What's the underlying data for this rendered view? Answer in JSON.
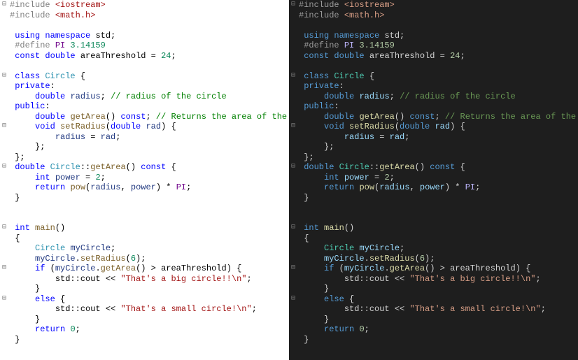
{
  "panes": [
    {
      "id": "light",
      "themeClass": "light"
    },
    {
      "id": "dark",
      "themeClass": "dark"
    }
  ],
  "code_lines": [
    {
      "fold": "-",
      "tokens": [
        [
          "t-pre",
          "#include "
        ],
        [
          "t-inc",
          "<iostream>"
        ]
      ]
    },
    {
      "fold": " ",
      "tokens": [
        [
          "t-pre",
          "#include "
        ],
        [
          "t-inc",
          "<math.h>"
        ]
      ]
    },
    {
      "fold": " ",
      "tokens": []
    },
    {
      "fold": " ",
      "tokens": [
        [
          "t-pl",
          " "
        ],
        [
          "t-kw",
          "using"
        ],
        [
          "t-pl",
          " "
        ],
        [
          "t-kw",
          "namespace"
        ],
        [
          "t-pl",
          " "
        ],
        [
          "t-id",
          "std"
        ],
        [
          "t-pl",
          ";"
        ]
      ]
    },
    {
      "fold": " ",
      "tokens": [
        [
          "t-pl",
          " "
        ],
        [
          "t-pre",
          "#define "
        ],
        [
          "t-macro",
          "PI"
        ],
        [
          "t-pl",
          " "
        ],
        [
          "t-num",
          "3.14159"
        ]
      ]
    },
    {
      "fold": " ",
      "tokens": [
        [
          "t-pl",
          " "
        ],
        [
          "t-kw",
          "const"
        ],
        [
          "t-pl",
          " "
        ],
        [
          "t-kw",
          "double"
        ],
        [
          "t-pl",
          " "
        ],
        [
          "t-id",
          "areaThreshold"
        ],
        [
          "t-pl",
          " = "
        ],
        [
          "t-num",
          "24"
        ],
        [
          "t-pl",
          ";"
        ]
      ]
    },
    {
      "fold": " ",
      "tokens": []
    },
    {
      "fold": "-",
      "tokens": [
        [
          "t-pl",
          " "
        ],
        [
          "t-kw",
          "class"
        ],
        [
          "t-pl",
          " "
        ],
        [
          "t-type",
          "Circle"
        ],
        [
          "t-pl",
          " {"
        ]
      ]
    },
    {
      "fold": " ",
      "tokens": [
        [
          "t-pl",
          " "
        ],
        [
          "t-lbl",
          "private"
        ],
        [
          "t-pl",
          ":"
        ]
      ]
    },
    {
      "fold": " ",
      "tokens": [
        [
          "t-pl",
          "     "
        ],
        [
          "t-kw",
          "double"
        ],
        [
          "t-pl",
          " "
        ],
        [
          "t-fld",
          "radius"
        ],
        [
          "t-pl",
          "; "
        ],
        [
          "t-cmt",
          "// radius of the circle"
        ]
      ]
    },
    {
      "fold": " ",
      "tokens": [
        [
          "t-pl",
          " "
        ],
        [
          "t-lbl",
          "public"
        ],
        [
          "t-pl",
          ":"
        ]
      ]
    },
    {
      "fold": " ",
      "tokens": [
        [
          "t-pl",
          "     "
        ],
        [
          "t-kw",
          "double"
        ],
        [
          "t-pl",
          " "
        ],
        [
          "t-func",
          "getArea"
        ],
        [
          "t-pl",
          "() "
        ],
        [
          "t-kw",
          "const"
        ],
        [
          "t-pl",
          "; "
        ],
        [
          "t-cmt",
          "// Returns the area of the circle"
        ]
      ]
    },
    {
      "fold": "-",
      "tokens": [
        [
          "t-pl",
          "     "
        ],
        [
          "t-kw",
          "void"
        ],
        [
          "t-pl",
          " "
        ],
        [
          "t-func",
          "setRadius"
        ],
        [
          "t-pl",
          "("
        ],
        [
          "t-kw",
          "double"
        ],
        [
          "t-pl",
          " "
        ],
        [
          "t-fld",
          "rad"
        ],
        [
          "t-pl",
          ") {"
        ]
      ]
    },
    {
      "fold": " ",
      "tokens": [
        [
          "t-pl",
          "         "
        ],
        [
          "t-fld",
          "radius"
        ],
        [
          "t-pl",
          " = "
        ],
        [
          "t-fld",
          "rad"
        ],
        [
          "t-pl",
          ";"
        ]
      ]
    },
    {
      "fold": " ",
      "tokens": [
        [
          "t-pl",
          "     };"
        ]
      ]
    },
    {
      "fold": " ",
      "tokens": [
        [
          "t-pl",
          " };"
        ]
      ]
    },
    {
      "fold": "-",
      "tokens": [
        [
          "t-pl",
          " "
        ],
        [
          "t-kw",
          "double"
        ],
        [
          "t-pl",
          " "
        ],
        [
          "t-scope",
          "Circle"
        ],
        [
          "t-pl",
          "::"
        ],
        [
          "t-func",
          "getArea"
        ],
        [
          "t-pl",
          "() "
        ],
        [
          "t-kw",
          "const"
        ],
        [
          "t-pl",
          " {"
        ]
      ]
    },
    {
      "fold": " ",
      "tokens": [
        [
          "t-pl",
          "     "
        ],
        [
          "t-kw",
          "int"
        ],
        [
          "t-pl",
          " "
        ],
        [
          "t-fld",
          "power"
        ],
        [
          "t-pl",
          " = "
        ],
        [
          "t-num",
          "2"
        ],
        [
          "t-pl",
          ";"
        ]
      ]
    },
    {
      "fold": " ",
      "tokens": [
        [
          "t-pl",
          "     "
        ],
        [
          "t-kw",
          "return"
        ],
        [
          "t-pl",
          " "
        ],
        [
          "t-func",
          "pow"
        ],
        [
          "t-pl",
          "("
        ],
        [
          "t-fld",
          "radius"
        ],
        [
          "t-pl",
          ", "
        ],
        [
          "t-fld",
          "power"
        ],
        [
          "t-pl",
          ") * "
        ],
        [
          "t-macro",
          "PI"
        ],
        [
          "t-pl",
          ";"
        ]
      ]
    },
    {
      "fold": " ",
      "tokens": [
        [
          "t-pl",
          " }"
        ]
      ]
    },
    {
      "fold": " ",
      "tokens": []
    },
    {
      "fold": " ",
      "tokens": []
    },
    {
      "fold": "-",
      "tokens": [
        [
          "t-pl",
          " "
        ],
        [
          "t-kw",
          "int"
        ],
        [
          "t-pl",
          " "
        ],
        [
          "t-func",
          "main"
        ],
        [
          "t-pl",
          "()"
        ]
      ]
    },
    {
      "fold": " ",
      "tokens": [
        [
          "t-pl",
          " {"
        ]
      ]
    },
    {
      "fold": " ",
      "tokens": [
        [
          "t-pl",
          "     "
        ],
        [
          "t-type",
          "Circle"
        ],
        [
          "t-pl",
          " "
        ],
        [
          "t-fld",
          "myCircle"
        ],
        [
          "t-pl",
          ";"
        ]
      ]
    },
    {
      "fold": " ",
      "tokens": [
        [
          "t-pl",
          "     "
        ],
        [
          "t-fld",
          "myCircle"
        ],
        [
          "t-pl",
          "."
        ],
        [
          "t-func",
          "setRadius"
        ],
        [
          "t-pl",
          "("
        ],
        [
          "t-num",
          "6"
        ],
        [
          "t-pl",
          ");"
        ]
      ]
    },
    {
      "fold": "-",
      "tokens": [
        [
          "t-pl",
          "     "
        ],
        [
          "t-kw",
          "if"
        ],
        [
          "t-pl",
          " ("
        ],
        [
          "t-fld",
          "myCircle"
        ],
        [
          "t-pl",
          "."
        ],
        [
          "t-func",
          "getArea"
        ],
        [
          "t-pl",
          "() > "
        ],
        [
          "t-id",
          "areaThreshold"
        ],
        [
          "t-pl",
          ") {"
        ]
      ]
    },
    {
      "fold": " ",
      "tokens": [
        [
          "t-pl",
          "         "
        ],
        [
          "t-id",
          "std"
        ],
        [
          "t-pl",
          "::"
        ],
        [
          "t-id",
          "cout"
        ],
        [
          "t-pl",
          " << "
        ],
        [
          "t-str",
          "\"That's a big circle!!\\n\""
        ],
        [
          "t-pl",
          ";"
        ]
      ]
    },
    {
      "fold": " ",
      "tokens": [
        [
          "t-pl",
          "     }"
        ]
      ]
    },
    {
      "fold": "-",
      "tokens": [
        [
          "t-pl",
          "     "
        ],
        [
          "t-kw",
          "else"
        ],
        [
          "t-pl",
          " {"
        ]
      ]
    },
    {
      "fold": " ",
      "tokens": [
        [
          "t-pl",
          "         "
        ],
        [
          "t-id",
          "std"
        ],
        [
          "t-pl",
          "::"
        ],
        [
          "t-id",
          "cout"
        ],
        [
          "t-pl",
          " << "
        ],
        [
          "t-str",
          "\"That's a small circle!\\n\""
        ],
        [
          "t-pl",
          ";"
        ]
      ]
    },
    {
      "fold": " ",
      "tokens": [
        [
          "t-pl",
          "     }"
        ]
      ]
    },
    {
      "fold": " ",
      "tokens": [
        [
          "t-pl",
          "     "
        ],
        [
          "t-kw",
          "return"
        ],
        [
          "t-pl",
          " "
        ],
        [
          "t-num",
          "0"
        ],
        [
          "t-pl",
          ";"
        ]
      ]
    },
    {
      "fold": " ",
      "tokens": [
        [
          "t-pl",
          " }"
        ]
      ]
    }
  ],
  "fold_glyphs": {
    "-": "⊟",
    "+": "⊞",
    " ": ""
  }
}
